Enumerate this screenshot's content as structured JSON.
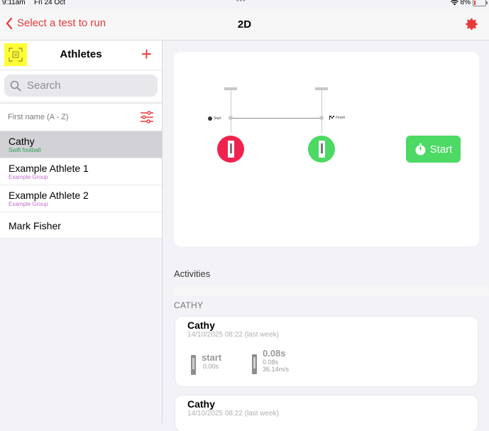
{
  "status": {
    "time": "9:11am",
    "date": "Fri 24 Oct",
    "battery": "8%"
  },
  "nav": {
    "back_label": "Select a test to run",
    "title": "2D"
  },
  "sidebar": {
    "title": "Athletes",
    "search_placeholder": "Search",
    "sort_label": "First name (A - Z)",
    "athletes": [
      {
        "name": "Cathy",
        "groups": "Swift   football",
        "group_color": "green",
        "selected": true
      },
      {
        "name": "Example  Athlete 1",
        "groups": "Example Group",
        "group_color": "purple"
      },
      {
        "name": "Example  Athlete 2",
        "groups": "Example Group",
        "group_color": "purple"
      },
      {
        "name": "Mark Fisher",
        "groups": ""
      }
    ]
  },
  "diagram": {
    "start_label": "Start",
    "finish_label": "Finish",
    "start_button": "Start"
  },
  "activities": {
    "title": "Activities",
    "group": "CATHY",
    "records": [
      {
        "name": "Cathy",
        "date": "14/10/2025 08:22 (last week)",
        "splits": [
          {
            "label": "start",
            "lines": [
              "0.00s"
            ]
          },
          {
            "label": "0.08s",
            "lines": [
              "0.08s",
              "36.14m/s"
            ]
          }
        ]
      },
      {
        "name": "Cathy",
        "date": "14/10/2025 08:22 (last week)"
      }
    ]
  },
  "colors": {
    "accent": "#e8393a",
    "green": "#4cd964",
    "red_gate": "#f0234f",
    "scan_highlight": "#ffff33"
  }
}
